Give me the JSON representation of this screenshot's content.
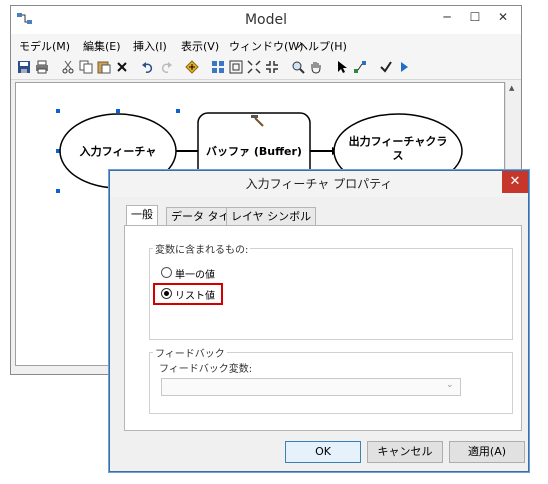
{
  "model_window": {
    "title": "Model",
    "minimize": "─",
    "maximize": "☐",
    "close": "✕"
  },
  "menu": [
    "モデル(M)",
    "編集(E)",
    "挿入(I)",
    "表示(V)",
    "ウィンドウ(W)",
    "ヘルプ(H)"
  ],
  "toolbar_icons": [
    "save-icon",
    "print-icon",
    "cut-icon",
    "copy-icon",
    "paste-icon",
    "delete-icon",
    "undo-icon",
    "redo-icon",
    "add-data-icon",
    "auto-layout-icon",
    "full-extent-icon",
    "zoom-fit-icon",
    "zoom-icon",
    "pan-icon",
    "select-icon",
    "connect-icon",
    "validate-icon",
    "run-icon"
  ],
  "diagram": {
    "input_label": "入力フィーチャ",
    "tool_label": "バッファ (Buffer)",
    "output_label_line1": "出力フィーチャクラ",
    "output_label_line2": "ス"
  },
  "colors": {
    "accent": "#0078d7",
    "highlight": "#d40000",
    "dialog_close": "#c7362b"
  },
  "dialog": {
    "title": "入力フィーチャ プロパティ",
    "close": "✕",
    "tabs": [
      "一般",
      "データ タイプ",
      "レイヤ シンボル"
    ],
    "active_tab": "一般",
    "group_variable": "変数に含まれるもの:",
    "radio_single": "単一の値",
    "radio_list": "リスト値",
    "selected_radio": "リスト値",
    "group_feedback": "フィードバック",
    "feedback_variable_label": "フィードバック変数:",
    "feedback_variable_value": "",
    "ok": "OK",
    "cancel": "キャンセル",
    "apply": "適用(A)"
  }
}
